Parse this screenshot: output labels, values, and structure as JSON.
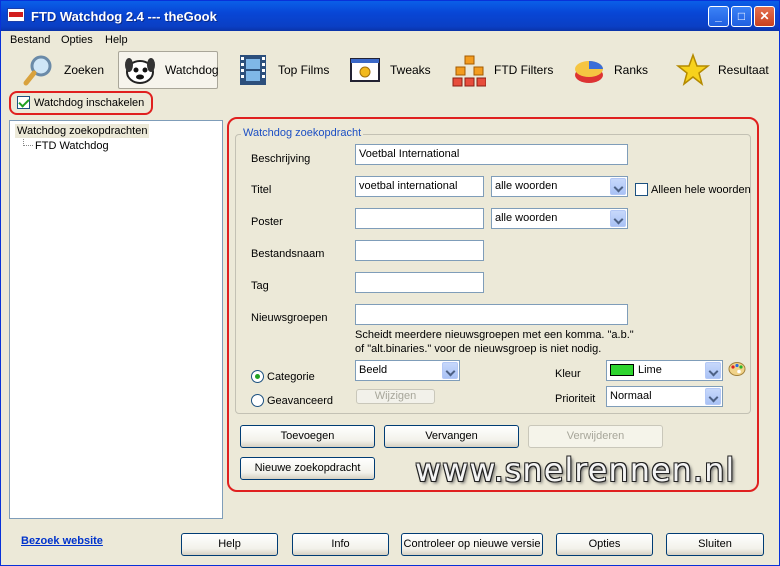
{
  "window": {
    "title": "FTD Watchdog 2.4 --- theGook",
    "minimize": "_",
    "maximize": "□",
    "close": "✕"
  },
  "menu": [
    "Bestand",
    "Opties",
    "Help"
  ],
  "toolbar": [
    {
      "label": "Zoeken",
      "icon": "magnifier-icon"
    },
    {
      "label": "Watchdog",
      "icon": "watchdog-icon"
    },
    {
      "label": "Top Films",
      "icon": "film-strip-icon"
    },
    {
      "label": "Tweaks",
      "icon": "tweaks-icon"
    },
    {
      "label": "FTD Filters",
      "icon": "filters-icon"
    },
    {
      "label": "Ranks",
      "icon": "ranks-icon"
    },
    {
      "label": "Resultaat",
      "icon": "star-icon"
    }
  ],
  "enable_checkbox": {
    "label": "Watchdog inschakelen",
    "checked": true
  },
  "tree": {
    "root": "Watchdog zoekopdrachten",
    "child": "FTD Watchdog"
  },
  "form": {
    "group_title": "Watchdog zoekopdracht",
    "beschrijving_label": "Beschrijving",
    "beschrijving_value": "Voetbal International",
    "titel_label": "Titel",
    "titel_value": "voetbal international",
    "titel_mode": "alle woorden",
    "hele_woorden_label": "Alleen hele woorden",
    "poster_label": "Poster",
    "poster_value": "",
    "poster_mode": "alle woorden",
    "bestandsnaam_label": "Bestandsnaam",
    "tag_label": "Tag",
    "nieuwsgroepen_label": "Nieuwsgroepen",
    "nieuwsgroepen_hint_1": "Scheidt meerdere nieuwsgroepen met een komma. \"a.b.\"",
    "nieuwsgroepen_hint_2": "of \"alt.binaries.\" voor de nieuwsgroep is niet nodig.",
    "categorie_label": "Categorie",
    "categorie_value": "Beeld",
    "geavanceerd_label": "Geavanceerd",
    "wijzigen_label": "Wijzigen",
    "kleur_label": "Kleur",
    "kleur_value": "Lime",
    "kleur_color": "#2fd42f",
    "prioriteit_label": "Prioriteit",
    "prioriteit_value": "Normaal"
  },
  "actions": {
    "toevoegen": "Toevoegen",
    "vervangen": "Vervangen",
    "verwijderen": "Verwijderen",
    "nieuwe": "Nieuwe zoekopdracht"
  },
  "watermark": "www.snelrennen.nl",
  "footer": {
    "website_link": "Bezoek website",
    "help": "Help",
    "info": "Info",
    "update": "Controleer op nieuwe versie",
    "opties": "Opties",
    "sluiten": "Sluiten"
  }
}
